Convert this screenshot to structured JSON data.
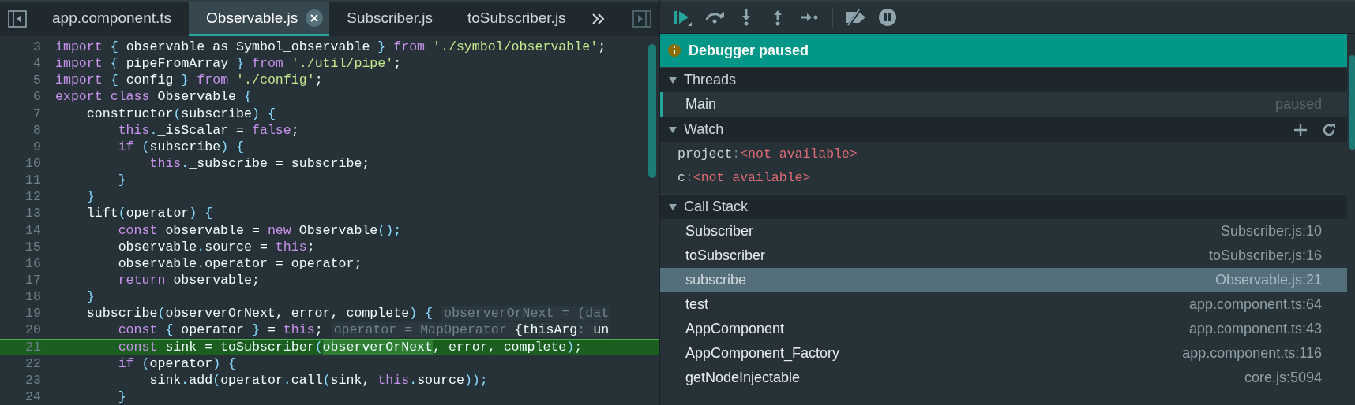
{
  "editor": {
    "tabs": [
      {
        "label": "app.component.ts",
        "selected": false
      },
      {
        "label": "Observable.js",
        "selected": true
      },
      {
        "label": "Subscriber.js",
        "selected": false
      },
      {
        "label": "toSubscriber.js",
        "selected": false
      }
    ],
    "lines": [
      {
        "number": "3",
        "current": false,
        "tokens": [
          {
            "kind": "kw",
            "text": "import "
          },
          {
            "kind": "pu",
            "text": "{"
          },
          {
            "kind": "tx",
            "text": " observable as Symbol_observable "
          },
          {
            "kind": "pu",
            "text": "} "
          },
          {
            "kind": "kw",
            "text": "from "
          },
          {
            "kind": "st",
            "text": "'./symbol/observable'"
          },
          {
            "kind": "tx",
            "text": ";"
          }
        ]
      },
      {
        "number": "4",
        "current": false,
        "tokens": [
          {
            "kind": "kw",
            "text": "import "
          },
          {
            "kind": "pu",
            "text": "{"
          },
          {
            "kind": "tx",
            "text": " pipeFromArray "
          },
          {
            "kind": "pu",
            "text": "} "
          },
          {
            "kind": "kw",
            "text": "from "
          },
          {
            "kind": "st",
            "text": "'./util/pipe'"
          },
          {
            "kind": "tx",
            "text": ";"
          }
        ]
      },
      {
        "number": "5",
        "current": false,
        "tokens": [
          {
            "kind": "kw",
            "text": "import "
          },
          {
            "kind": "pu",
            "text": "{"
          },
          {
            "kind": "tx",
            "text": " config "
          },
          {
            "kind": "pu",
            "text": "} "
          },
          {
            "kind": "kw",
            "text": "from "
          },
          {
            "kind": "st",
            "text": "'./config'"
          },
          {
            "kind": "tx",
            "text": ";"
          }
        ]
      },
      {
        "number": "6",
        "current": false,
        "tokens": [
          {
            "kind": "kw",
            "text": "export class"
          },
          {
            "kind": "tx",
            "text": " Observable "
          },
          {
            "kind": "pu",
            "text": "{"
          }
        ]
      },
      {
        "number": "7",
        "current": false,
        "tokens": [
          {
            "kind": "tx",
            "text": "    constructor"
          },
          {
            "kind": "pu",
            "text": "("
          },
          {
            "kind": "tx",
            "text": "subscribe"
          },
          {
            "kind": "pu",
            "text": ") {"
          }
        ]
      },
      {
        "number": "8",
        "current": false,
        "tokens": [
          {
            "kind": "kw",
            "text": "        this"
          },
          {
            "kind": "pu",
            "text": "."
          },
          {
            "kind": "tx",
            "text": "_isScalar = "
          },
          {
            "kind": "kw",
            "text": "false"
          },
          {
            "kind": "tx",
            "text": ";"
          }
        ]
      },
      {
        "number": "9",
        "current": false,
        "tokens": [
          {
            "kind": "kw",
            "text": "        if"
          },
          {
            "kind": "pu",
            "text": " ("
          },
          {
            "kind": "tx",
            "text": "subscribe"
          },
          {
            "kind": "pu",
            "text": ") {"
          }
        ]
      },
      {
        "number": "10",
        "current": false,
        "tokens": [
          {
            "kind": "kw",
            "text": "            this"
          },
          {
            "kind": "pu",
            "text": "."
          },
          {
            "kind": "tx",
            "text": "_subscribe = subscribe;"
          }
        ]
      },
      {
        "number": "11",
        "current": false,
        "tokens": [
          {
            "kind": "pu",
            "text": "        }"
          }
        ]
      },
      {
        "number": "12",
        "current": false,
        "tokens": [
          {
            "kind": "pu",
            "text": "    }"
          }
        ]
      },
      {
        "number": "13",
        "current": false,
        "tokens": [
          {
            "kind": "tx",
            "text": "    lift"
          },
          {
            "kind": "pu",
            "text": "("
          },
          {
            "kind": "tx",
            "text": "operator"
          },
          {
            "kind": "pu",
            "text": ") {"
          }
        ]
      },
      {
        "number": "14",
        "current": false,
        "tokens": [
          {
            "kind": "kw",
            "text": "        const"
          },
          {
            "kind": "tx",
            "text": " observable = "
          },
          {
            "kind": "kw",
            "text": "new"
          },
          {
            "kind": "tx",
            "text": " Observable"
          },
          {
            "kind": "pu",
            "text": "();"
          }
        ]
      },
      {
        "number": "15",
        "current": false,
        "tokens": [
          {
            "kind": "tx",
            "text": "        observable"
          },
          {
            "kind": "pu",
            "text": "."
          },
          {
            "kind": "tx",
            "text": "source = "
          },
          {
            "kind": "kw",
            "text": "this"
          },
          {
            "kind": "tx",
            "text": ";"
          }
        ]
      },
      {
        "number": "16",
        "current": false,
        "tokens": [
          {
            "kind": "tx",
            "text": "        observable"
          },
          {
            "kind": "pu",
            "text": "."
          },
          {
            "kind": "tx",
            "text": "operator = operator;"
          }
        ]
      },
      {
        "number": "17",
        "current": false,
        "tokens": [
          {
            "kind": "kw",
            "text": "        return"
          },
          {
            "kind": "tx",
            "text": " observable;"
          }
        ]
      },
      {
        "number": "18",
        "current": false,
        "tokens": [
          {
            "kind": "pu",
            "text": "    }"
          }
        ]
      },
      {
        "number": "19",
        "current": false,
        "tokens": [
          {
            "kind": "tx",
            "text": "    subscribe"
          },
          {
            "kind": "pu",
            "text": "("
          },
          {
            "kind": "tx",
            "text": "observerOrNext, error, complete"
          },
          {
            "kind": "pu",
            "text": ") {"
          }
        ],
        "hint": [
          {
            "kind": "dim",
            "text": "observerOrNext = (dat"
          }
        ]
      },
      {
        "number": "20",
        "current": false,
        "tokens": [
          {
            "kind": "kw",
            "text": "        const"
          },
          {
            "kind": "pu",
            "text": " {"
          },
          {
            "kind": "tx",
            "text": " operator "
          },
          {
            "kind": "pu",
            "text": "}"
          },
          {
            "kind": "tx",
            "text": " = "
          },
          {
            "kind": "kw",
            "text": "this"
          },
          {
            "kind": "tx",
            "text": ";"
          }
        ],
        "hint": [
          {
            "kind": "dim",
            "text": "operator = MapOperator "
          },
          {
            "kind": "tx",
            "text": "{thisArg"
          },
          {
            "kind": "dim",
            "text": ": "
          },
          {
            "kind": "tx",
            "text": "un"
          }
        ]
      },
      {
        "number": "21",
        "current": true,
        "tokens": [
          {
            "kind": "kw",
            "text": "        const"
          },
          {
            "kind": "tx",
            "text": " sink = toSubscriber"
          },
          {
            "kind": "pu",
            "text": "("
          },
          {
            "kind": "hl",
            "text": "observerOrNext"
          },
          {
            "kind": "tx",
            "text": ", error, complete"
          },
          {
            "kind": "pu",
            "text": ")"
          },
          {
            "kind": "tx",
            "text": ";"
          }
        ]
      },
      {
        "number": "22",
        "current": false,
        "tokens": [
          {
            "kind": "kw",
            "text": "        if"
          },
          {
            "kind": "pu",
            "text": " ("
          },
          {
            "kind": "tx",
            "text": "operator"
          },
          {
            "kind": "pu",
            "text": ") {"
          }
        ]
      },
      {
        "number": "23",
        "current": false,
        "tokens": [
          {
            "kind": "tx",
            "text": "            sink"
          },
          {
            "kind": "pu",
            "text": "."
          },
          {
            "kind": "tx",
            "text": "add"
          },
          {
            "kind": "pu",
            "text": "("
          },
          {
            "kind": "tx",
            "text": "operator"
          },
          {
            "kind": "pu",
            "text": "."
          },
          {
            "kind": "tx",
            "text": "call"
          },
          {
            "kind": "pu",
            "text": "("
          },
          {
            "kind": "tx",
            "text": "sink, "
          },
          {
            "kind": "kw",
            "text": "this"
          },
          {
            "kind": "pu",
            "text": "."
          },
          {
            "kind": "tx",
            "text": "source"
          },
          {
            "kind": "pu",
            "text": "));"
          }
        ]
      },
      {
        "number": "24",
        "current": false,
        "tokens": [
          {
            "kind": "pu",
            "text": "        }"
          }
        ]
      }
    ]
  },
  "debugger": {
    "banner": "Debugger paused",
    "threads": {
      "title": "Threads",
      "expanded": true,
      "items": [
        {
          "name": "Main",
          "status": "paused",
          "selected": true
        }
      ]
    },
    "watch": {
      "title": "Watch",
      "expanded": true,
      "items": [
        {
          "name": "project",
          "separator": ":",
          "value": "<not available>"
        },
        {
          "name": "c",
          "separator": ":",
          "value": "<not available>"
        }
      ]
    },
    "call_stack": {
      "title": "Call Stack",
      "expanded": true,
      "frames": [
        {
          "name": "Subscriber",
          "location": "Subscriber.js:10",
          "selected": false
        },
        {
          "name": "toSubscriber",
          "location": "toSubscriber.js:16",
          "selected": false
        },
        {
          "name": "subscribe",
          "location": "Observable.js:21",
          "selected": true
        },
        {
          "name": "test",
          "location": "app.component.ts:64",
          "selected": false
        },
        {
          "name": "AppComponent",
          "location": "app.component.ts:43",
          "selected": false
        },
        {
          "name": "AppComponent_Factory",
          "location": "app.component.ts:116",
          "selected": false
        },
        {
          "name": "getNodeInjectable",
          "location": "core.js:5094",
          "selected": false
        }
      ]
    }
  }
}
